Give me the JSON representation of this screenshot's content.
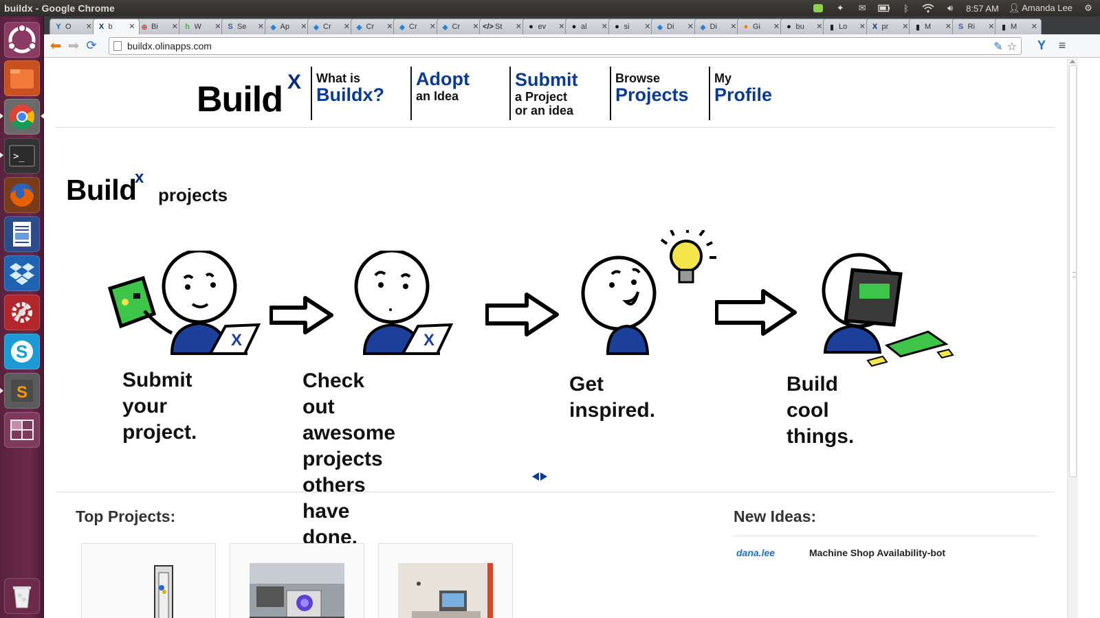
{
  "os": {
    "window_title": "buildx - Google Chrome",
    "clock": "8:57 AM",
    "user": "Amanda Lee",
    "indicators": [
      "battery-icon",
      "mail-icon",
      "bluetooth-icon",
      "wifi-icon",
      "volume-icon",
      "settings-gear-icon"
    ],
    "launcher_items": [
      "ubuntu-dash-icon",
      "files-icon",
      "chrome-icon",
      "terminal-icon",
      "firefox-icon",
      "writer-icon",
      "dropbox-icon",
      "system-settings-icon",
      "skype-icon",
      "sublime-text-icon",
      "workspace-switcher-icon",
      "trash-icon"
    ]
  },
  "browser": {
    "tabs": [
      {
        "label": "O",
        "favicon": "Y",
        "color": "#1a5fb4"
      },
      {
        "label": "b",
        "favicon": "X",
        "color": "#0b2d7a",
        "active": true
      },
      {
        "label": "Bi",
        "favicon": "⊕",
        "color": "#c0392b"
      },
      {
        "label": "W",
        "favicon": "h",
        "color": "#4caf50"
      },
      {
        "label": "Se",
        "favicon": "S",
        "color": "#3b5998"
      },
      {
        "label": "Ap",
        "favicon": "◆",
        "color": "#2b83d6"
      },
      {
        "label": "Cr",
        "favicon": "◆",
        "color": "#2b83d6"
      },
      {
        "label": "Cr",
        "favicon": "◆",
        "color": "#2b83d6"
      },
      {
        "label": "Cr",
        "favicon": "◆",
        "color": "#2b83d6"
      },
      {
        "label": "Cr",
        "favicon": "◆",
        "color": "#2b83d6"
      },
      {
        "label": "St",
        "favicon": "</>",
        "color": "#222222"
      },
      {
        "label": "ev",
        "favicon": "●",
        "color": "#111111"
      },
      {
        "label": "al",
        "favicon": "●",
        "color": "#111111"
      },
      {
        "label": "si",
        "favicon": "●",
        "color": "#111111"
      },
      {
        "label": "Di",
        "favicon": "◆",
        "color": "#2b83d6"
      },
      {
        "label": "Di",
        "favicon": "◆",
        "color": "#2b83d6"
      },
      {
        "label": "Gi",
        "favicon": "●",
        "color": "#f57c00"
      },
      {
        "label": "bu",
        "favicon": "●",
        "color": "#111111"
      },
      {
        "label": "Lo",
        "favicon": "▮",
        "color": "#222222"
      },
      {
        "label": "pr",
        "favicon": "X",
        "color": "#0b2d7a"
      },
      {
        "label": "M",
        "favicon": "▮",
        "color": "#222222"
      },
      {
        "label": "Ri",
        "favicon": "S",
        "color": "#3b5998"
      },
      {
        "label": "M",
        "favicon": "▮",
        "color": "#222222"
      }
    ],
    "url": "buildx.olinapps.com"
  },
  "site": {
    "logo": {
      "word": "Build",
      "sup": "X"
    },
    "nav": [
      {
        "small": "What is",
        "big": "Buildx?",
        "order": "small-big"
      },
      {
        "big": "Adopt",
        "small": "an Idea",
        "order": "big-small"
      },
      {
        "big": "Submit",
        "small": "a Project",
        "small2": "or an idea",
        "order": "big-small"
      },
      {
        "small": "Browse",
        "big": "Projects",
        "order": "small-big"
      },
      {
        "small": "My",
        "big": "Profile",
        "order": "small-big"
      }
    ],
    "section": {
      "word": "Build",
      "sup": "x",
      "subtitle": "projects"
    },
    "slides": [
      {
        "caption": [
          "Submit your",
          "project."
        ]
      },
      {
        "caption": [
          "Check out awesome",
          "projects others have",
          "done."
        ]
      },
      {
        "caption": [
          "Get inspired."
        ]
      },
      {
        "caption": [
          "Build cool things."
        ]
      }
    ],
    "top_projects_heading": "Top Projects:",
    "new_ideas_heading": "New Ideas:",
    "ideas": [
      {
        "author": "dana.lee",
        "title": "Machine Shop Availability-bot"
      }
    ],
    "colors": {
      "brand_navy": "#0b2d7a",
      "link_blue": "#1d6fb8"
    }
  }
}
